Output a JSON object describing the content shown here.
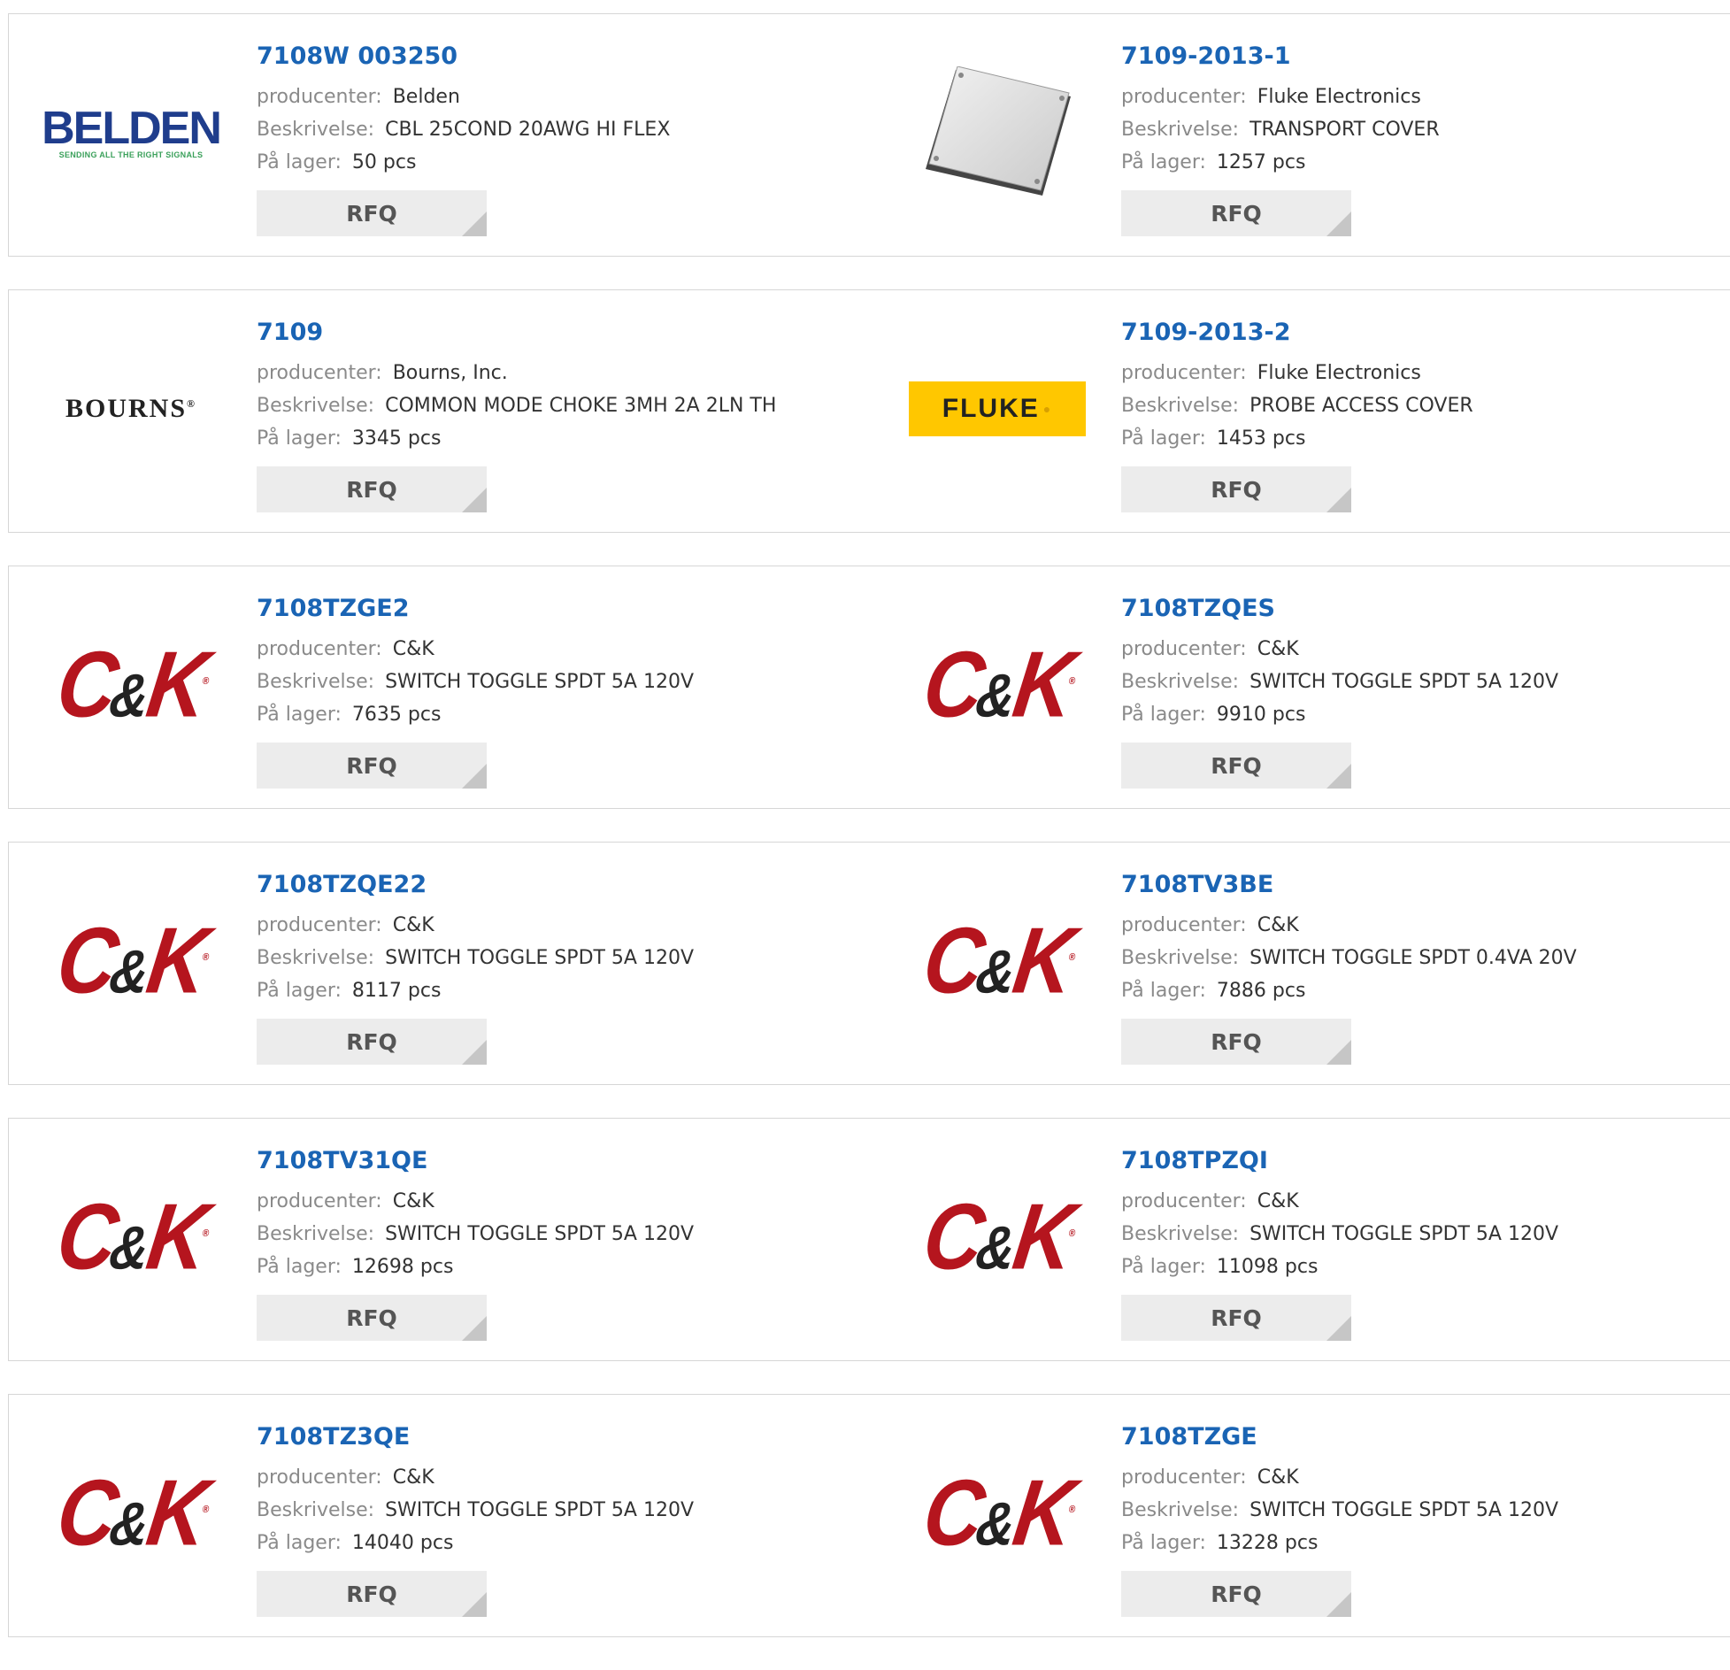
{
  "labels": {
    "producer": "producenter:",
    "description": "Beskrivelse:",
    "stock": "På lager:",
    "rfq": "RFQ"
  },
  "products": [
    {
      "part": "7108W 003250",
      "manufacturer": "Belden",
      "description": "CBL 25COND 20AWG HI FLEX",
      "stock": "50 pcs",
      "logo": "belden-logo"
    },
    {
      "part": "7109-2013-1",
      "manufacturer": "Fluke Electronics",
      "description": "TRANSPORT COVER",
      "stock": "1257 pcs",
      "logo": "transport-cover-product-image"
    },
    {
      "part": "7109",
      "manufacturer": "Bourns, Inc.",
      "description": "COMMON MODE CHOKE 3MH 2A 2LN TH",
      "stock": "3345 pcs",
      "logo": "bourns-logo"
    },
    {
      "part": "7109-2013-2",
      "manufacturer": "Fluke Electronics",
      "description": "PROBE ACCESS COVER",
      "stock": "1453 pcs",
      "logo": "fluke-logo"
    },
    {
      "part": "7108TZGE2",
      "manufacturer": "C&K",
      "description": "SWITCH TOGGLE SPDT 5A 120V",
      "stock": "7635 pcs",
      "logo": "ck-logo"
    },
    {
      "part": "7108TZQES",
      "manufacturer": "C&K",
      "description": "SWITCH TOGGLE SPDT 5A 120V",
      "stock": "9910 pcs",
      "logo": "ck-logo"
    },
    {
      "part": "7108TZQE22",
      "manufacturer": "C&K",
      "description": "SWITCH TOGGLE SPDT 5A 120V",
      "stock": "8117 pcs",
      "logo": "ck-logo"
    },
    {
      "part": "7108TV3BE",
      "manufacturer": "C&K",
      "description": "SWITCH TOGGLE SPDT 0.4VA 20V",
      "stock": "7886 pcs",
      "logo": "ck-logo"
    },
    {
      "part": "7108TV31QE",
      "manufacturer": "C&K",
      "description": "SWITCH TOGGLE SPDT 5A 120V",
      "stock": "12698 pcs",
      "logo": "ck-logo"
    },
    {
      "part": "7108TPZQI",
      "manufacturer": "C&K",
      "description": "SWITCH TOGGLE SPDT 5A 120V",
      "stock": "11098 pcs",
      "logo": "ck-logo"
    },
    {
      "part": "7108TZ3QE",
      "manufacturer": "C&K",
      "description": "SWITCH TOGGLE SPDT 5A 120V",
      "stock": "14040 pcs",
      "logo": "ck-logo"
    },
    {
      "part": "7108TZGE",
      "manufacturer": "C&K",
      "description": "SWITCH TOGGLE SPDT 5A 120V",
      "stock": "13228 pcs",
      "logo": "ck-logo"
    }
  ],
  "colors": {
    "part_link": "#1a64b4",
    "label": "#8a8a8a",
    "ck_red": "#b5151e",
    "fluke_yellow": "#ffc700",
    "belden_blue": "#1f3d8c"
  }
}
